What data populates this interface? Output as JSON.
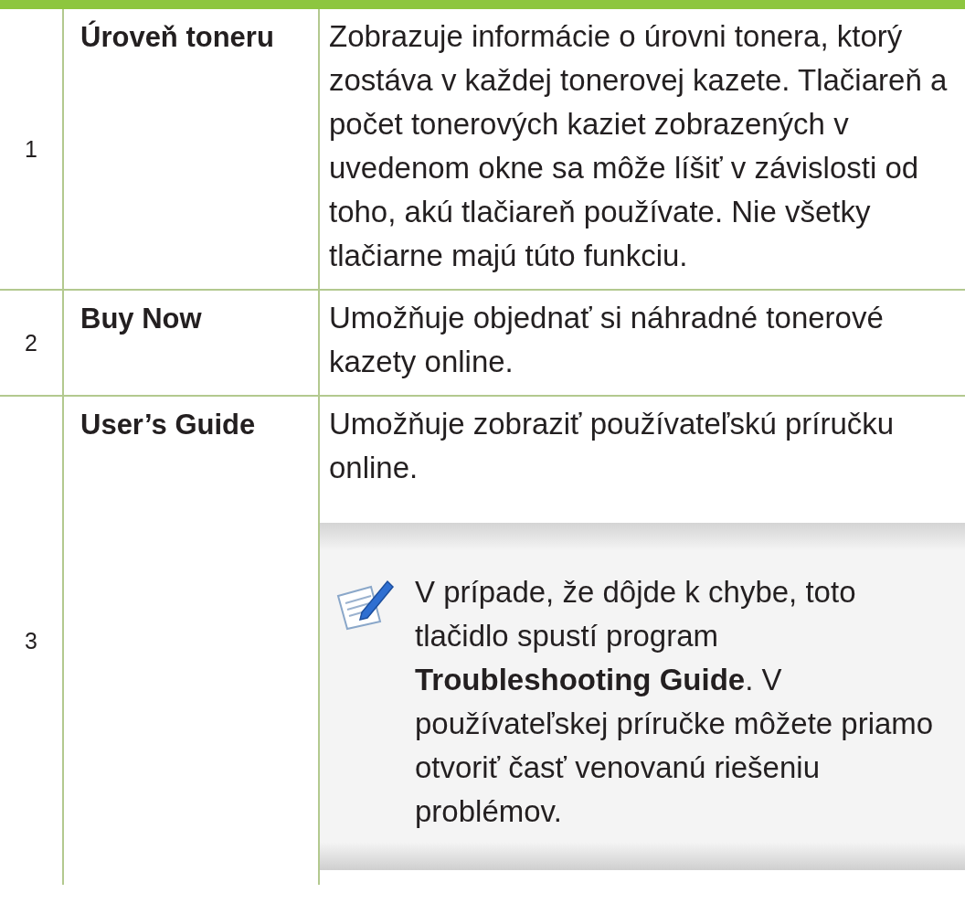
{
  "rows": [
    {
      "number": "1",
      "name": "Úroveň toneru",
      "description": "Zobrazuje informácie o úrovni tonera, ktorý zostáva v každej tonerovej kazete. Tlačiareň a počet tonerových kaziet zobrazených v uvedenom okne sa môže líšiť v závislosti od toho, akú tlačiareň používate. Nie všetky tlačiarne majú túto funkciu."
    },
    {
      "number": "2",
      "name": "Buy Now",
      "description": "Umožňuje objednať si náhradné tonerové kazety online."
    },
    {
      "number": "3",
      "name": "User’s Guide",
      "description": "Umožňuje zobraziť používateľskú príručku online.",
      "note": "V prípade, že dôjde k chybe, toto tlačidlo spustí program **Troubleshooting Guide**. V používateľskej príručke môžete priamo otvoriť časť venovanú riešeniu problémov."
    }
  ]
}
